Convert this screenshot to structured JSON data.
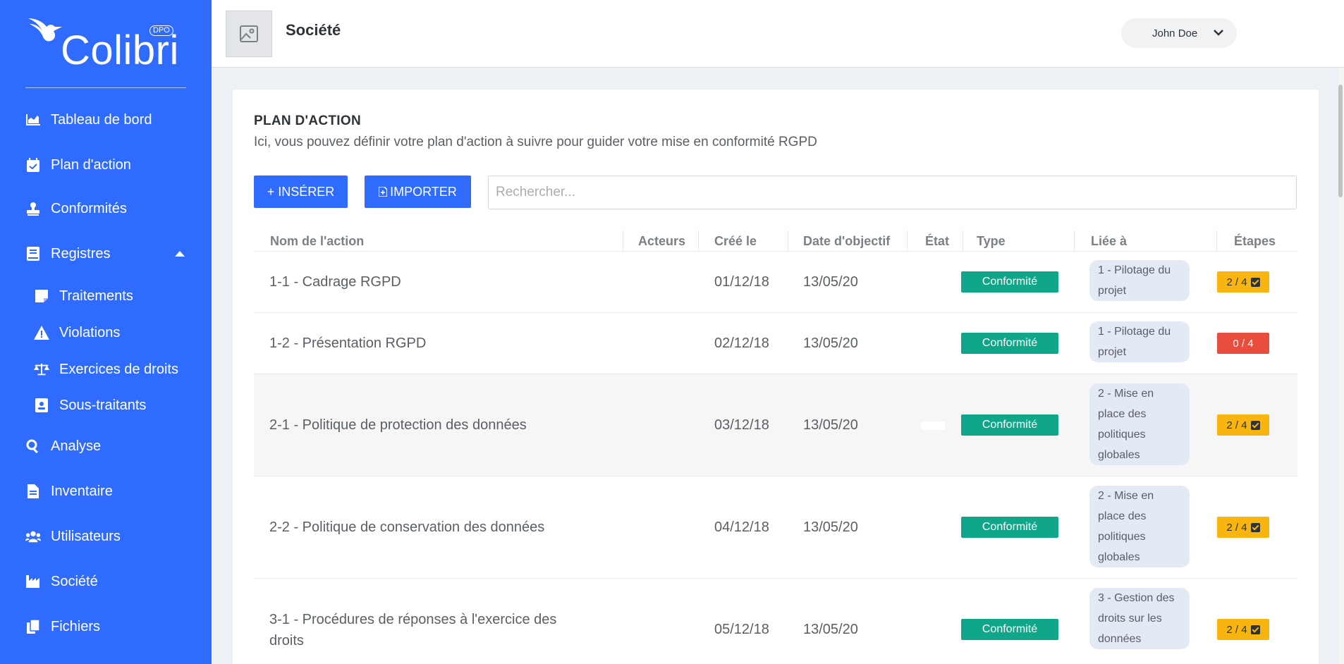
{
  "brand": {
    "name": "Colibri",
    "tag": "DPO",
    "accent": "#2f6bff"
  },
  "sidebar": {
    "items": [
      {
        "label": "Tableau de bord",
        "icon": "chart-area-icon"
      },
      {
        "label": "Plan d'action",
        "icon": "calendar-check-icon"
      },
      {
        "label": "Conformités",
        "icon": "stamp-icon"
      },
      {
        "label": "Registres",
        "icon": "book-icon"
      },
      {
        "label": "Analyse",
        "icon": "search-icon"
      },
      {
        "label": "Inventaire",
        "icon": "file-alt-icon"
      },
      {
        "label": "Utilisateurs",
        "icon": "users-icon"
      },
      {
        "label": "Société",
        "icon": "industry-icon"
      },
      {
        "label": "Fichiers",
        "icon": "copy-icon"
      }
    ],
    "sub_items": [
      {
        "label": "Traitements",
        "icon": "sticky-note-icon"
      },
      {
        "label": "Violations",
        "icon": "warning-icon"
      },
      {
        "label": "Exercices de droits",
        "icon": "balance-scale-icon"
      },
      {
        "label": "Sous-traitants",
        "icon": "id-badge-icon"
      }
    ]
  },
  "header": {
    "title": "Société",
    "user": "John Doe"
  },
  "page": {
    "title": "PLAN D'ACTION",
    "subtitle": "Ici, vous pouvez définir votre plan d'action à suivre pour guider votre mise en conformité RGPD",
    "insert_label": "+ INSÉRER",
    "import_label": "IMPORTER",
    "search_placeholder": "Rechercher..."
  },
  "table": {
    "headers": [
      "Nom de l'action",
      "Acteurs",
      "Créé le",
      "Date d'objectif",
      "État",
      "Type",
      "Liée à",
      "Étapes"
    ],
    "rows": [
      {
        "name": "1-1 - Cadrage RGPD",
        "created": "01/12/18",
        "target": "13/05/20",
        "type": "Conformité",
        "linked": "1 - Pilotage du projet",
        "steps": "2 / 4",
        "steps_status": "ok"
      },
      {
        "name": "1-2 - Présentation RGPD",
        "created": "02/12/18",
        "target": "13/05/20",
        "type": "Conformité",
        "linked": "1 - Pilotage du projet",
        "steps": "0 / 4",
        "steps_status": "bad"
      },
      {
        "name": "2-1 - Politique de protection des données",
        "created": "03/12/18",
        "target": "13/05/20",
        "type": "Conformité",
        "linked": "2 - Mise en place des politiques globales",
        "steps": "2 / 4",
        "steps_status": "ok"
      },
      {
        "name": "2-2 - Politique de conservation des données",
        "created": "04/12/18",
        "target": "13/05/20",
        "type": "Conformité",
        "linked": "2 - Mise en place des politiques globales",
        "steps": "2 / 4",
        "steps_status": "ok"
      },
      {
        "name": "3-1 - Procédures de réponses à l'exercice des droits",
        "created": "05/12/18",
        "target": "13/05/20",
        "type": "Conformité",
        "linked": "3 - Gestion des droits sur les données",
        "steps": "2 / 4",
        "steps_status": "ok"
      }
    ]
  },
  "colors": {
    "type_badge": "#0fa68a",
    "steps_ok": "#f9b50f",
    "steps_bad": "#e84d3d",
    "linked_bg": "#e4e9f6"
  }
}
